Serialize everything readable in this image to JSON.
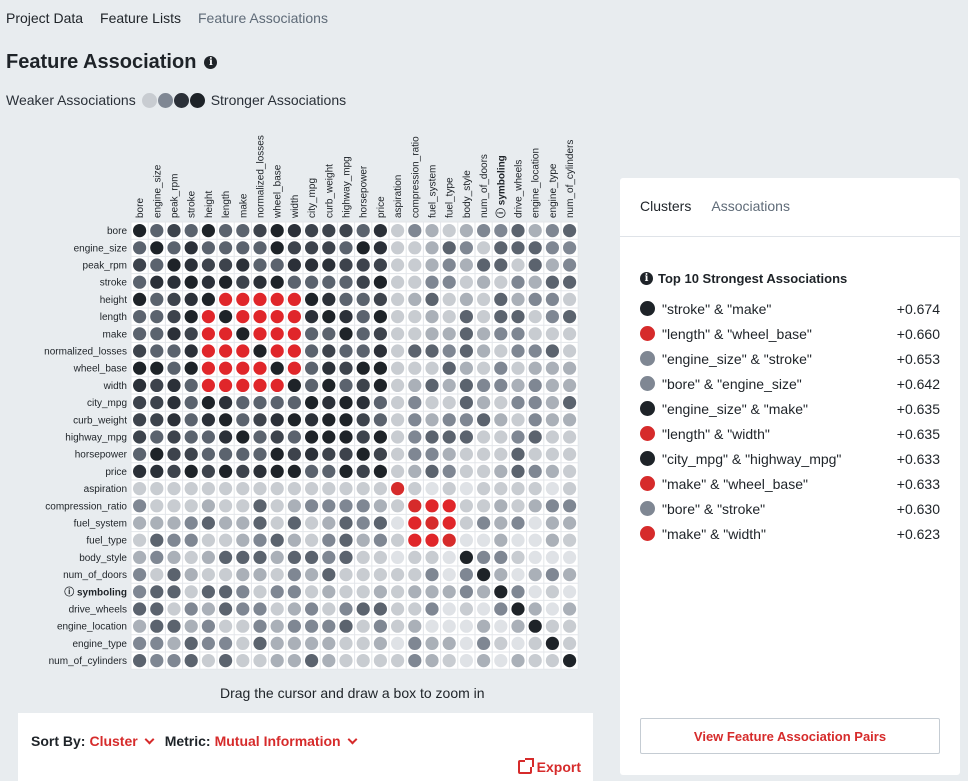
{
  "tabs": [
    {
      "label": "Project Data",
      "active": true
    },
    {
      "label": "Feature Lists",
      "active": true
    },
    {
      "label": "Feature Associations",
      "active": false
    }
  ],
  "title": "Feature Association",
  "legend": {
    "weaker": "Weaker Associations",
    "stronger": "Stronger Associations",
    "colors": [
      "#c8ccd1",
      "#7f8793",
      "#2b3038",
      "#1e2328"
    ]
  },
  "matrix": {
    "features": [
      "bore",
      "engine_size",
      "peak_rpm",
      "stroke",
      "height",
      "length",
      "make",
      "normalized_losses",
      "wheel_base",
      "width",
      "city_mpg",
      "curb_weight",
      "highway_mpg",
      "horsepower",
      "price",
      "aspiration",
      "compression_ratio",
      "fuel_system",
      "fuel_type",
      "body_style",
      "num_of_doors",
      "symboling",
      "drive_wheels",
      "engine_location",
      "engine_type",
      "num_of_cylinders"
    ],
    "target_feature": "symboling",
    "clusters": {
      "red": [
        "height",
        "length",
        "make",
        "normalized_losses",
        "wheel_base",
        "width"
      ],
      "red2": [
        "aspiration",
        "compression_ratio",
        "fuel_system",
        "fuel_type"
      ]
    }
  },
  "hint": "Drag the cursor and draw a box to zoom in",
  "controls": {
    "sort_label": "Sort By:",
    "sort_value": "Cluster",
    "metric_label": "Metric:",
    "metric_value": "Mutual Information",
    "export": "Export"
  },
  "side": {
    "tabs": [
      "Clusters",
      "Associations"
    ],
    "top_title": "Top 10 Strongest Associations",
    "associations": [
      {
        "label": "\"stroke\" & \"make\"",
        "value": "+0.674",
        "color": "#1e2328"
      },
      {
        "label": "\"length\" & \"wheel_base\"",
        "value": "+0.660",
        "color": "#d62b2b"
      },
      {
        "label": "\"engine_size\" & \"stroke\"",
        "value": "+0.653",
        "color": "#7f8793"
      },
      {
        "label": "\"bore\" & \"engine_size\"",
        "value": "+0.642",
        "color": "#7f8793"
      },
      {
        "label": "\"engine_size\" & \"make\"",
        "value": "+0.635",
        "color": "#1e2328"
      },
      {
        "label": "\"length\" & \"width\"",
        "value": "+0.635",
        "color": "#d62b2b"
      },
      {
        "label": "\"city_mpg\" & \"highway_mpg\"",
        "value": "+0.633",
        "color": "#1e2328"
      },
      {
        "label": "\"make\" & \"wheel_base\"",
        "value": "+0.633",
        "color": "#d62b2b"
      },
      {
        "label": "\"bore\" & \"stroke\"",
        "value": "+0.630",
        "color": "#7f8793"
      },
      {
        "label": "\"make\" & \"width\"",
        "value": "+0.623",
        "color": "#d62b2b"
      }
    ],
    "view_button": "View Feature Association Pairs"
  }
}
